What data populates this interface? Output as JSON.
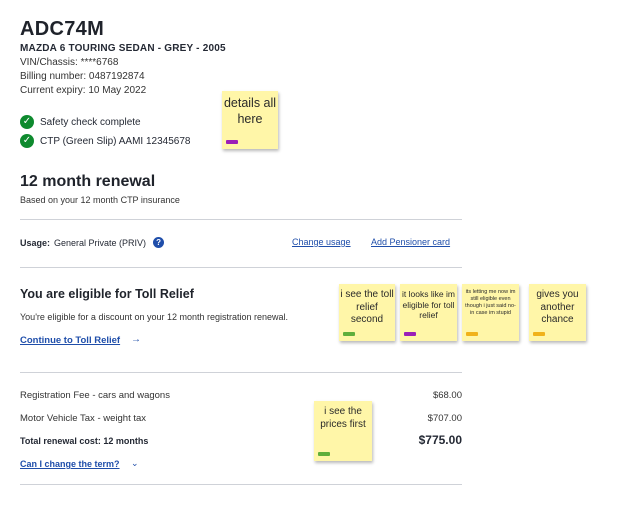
{
  "vehicle": {
    "plate": "ADC74M",
    "description": "MAZDA 6 TOURING SEDAN - GREY - 2005",
    "vin": "VIN/Chassis: ****6768",
    "billing": "Billing number: 0487192874",
    "expiry": "Current expiry: 10 May 2022",
    "checks": [
      "Safety check complete",
      "CTP (Green Slip) AAMI 12345678"
    ]
  },
  "renewal": {
    "title": "12 month renewal",
    "subtitle": "Based on your 12 month CTP insurance"
  },
  "usage": {
    "label": "Usage:",
    "value": "General Private (PRIV)",
    "help_icon": "?",
    "change_link": "Change usage",
    "pensioner_link": "Add Pensioner card"
  },
  "toll_relief": {
    "title": "You are eligible for Toll Relief",
    "text": "You're eligible for a discount on your 12 month registration renewal.",
    "cta": "Continue to Toll Relief",
    "cta_arrow": "→"
  },
  "fees": [
    {
      "label": "Registration Fee - cars and wagons",
      "value": "$68.00"
    },
    {
      "label": "Motor Vehicle Tax - weight tax",
      "value": "$707.00"
    }
  ],
  "total": {
    "label": "Total renewal cost: 12 months",
    "value": "$775.00"
  },
  "term_link": "Can I change the term?",
  "term_chevron": "⌄",
  "stickies": [
    {
      "text": "details all here",
      "tag_color": "#9b1fb8"
    },
    {
      "text": "i see the toll relief second",
      "tag_color": "#5fae3b"
    },
    {
      "text": "it looks like im eligible for toll relief",
      "tag_color": "#9b1fb8"
    },
    {
      "text": "its letting me now im still eligible even though i just said no- in case im stupid",
      "tag_color": "#f0b21b"
    },
    {
      "text": "gives you another chance",
      "tag_color": "#f0b21b"
    },
    {
      "text": "i see the prices first",
      "tag_color": "#5fae3b"
    }
  ],
  "colors": {
    "link": "#1f4eaa",
    "check": "#0e8a2e",
    "sticky": "#fff6a8"
  }
}
